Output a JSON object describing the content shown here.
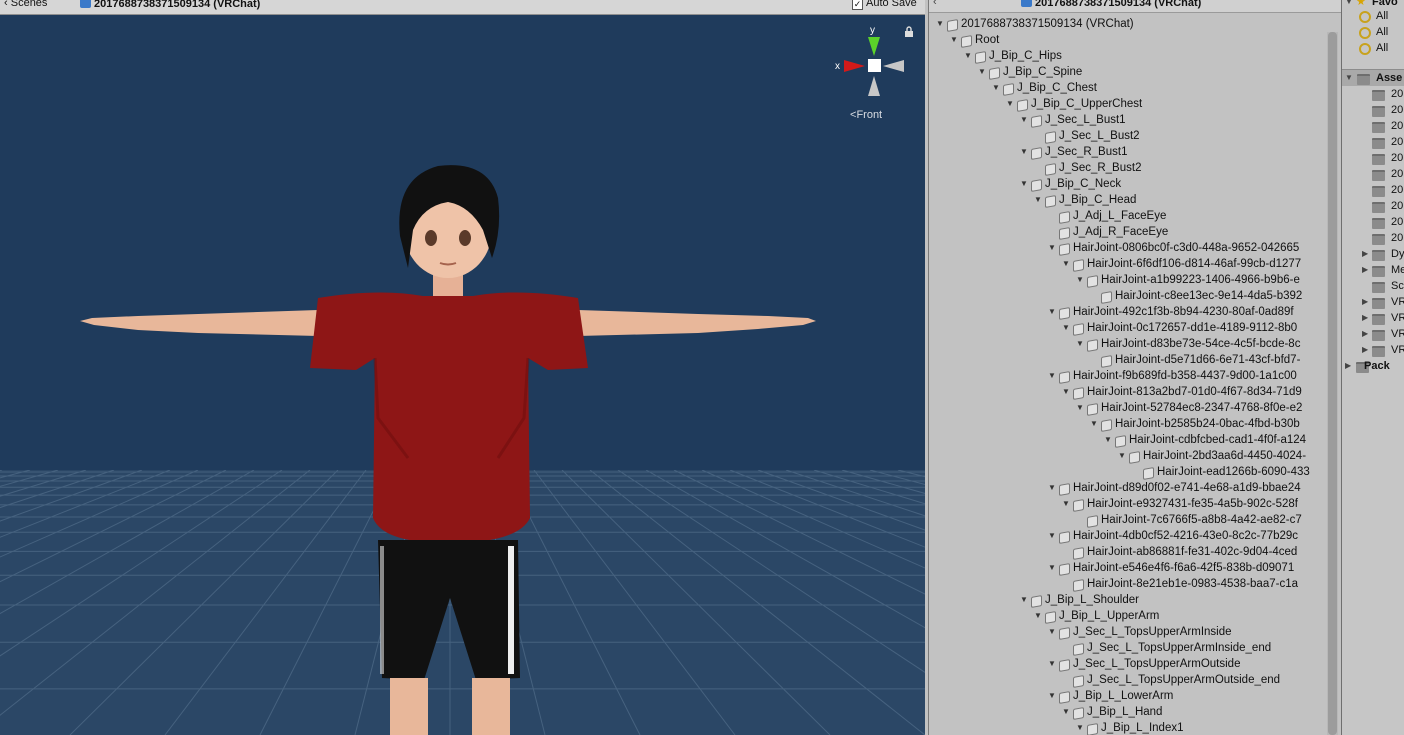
{
  "scene": {
    "tab_label": "Scenes",
    "prefab_title": "2017688738371509134 (VRChat)",
    "auto_save_label": "Auto Save",
    "auto_save_checked": true,
    "gizmo": {
      "axis_y": "y",
      "axis_x": "x",
      "view_label": "Front"
    },
    "background_color": "#1f3b5c"
  },
  "hierarchy": {
    "title": "2017688738371509134 (VRChat)",
    "rows": [
      {
        "label": "2017688738371509134 (VRChat)",
        "depth": 0,
        "expanded": true
      },
      {
        "label": "Root",
        "depth": 1,
        "expanded": true
      },
      {
        "label": "J_Bip_C_Hips",
        "depth": 2,
        "expanded": true
      },
      {
        "label": "J_Bip_C_Spine",
        "depth": 3,
        "expanded": true
      },
      {
        "label": "J_Bip_C_Chest",
        "depth": 4,
        "expanded": true
      },
      {
        "label": "J_Bip_C_UpperChest",
        "depth": 5,
        "expanded": true
      },
      {
        "label": "J_Sec_L_Bust1",
        "depth": 6,
        "expanded": true
      },
      {
        "label": "J_Sec_L_Bust2",
        "depth": 7,
        "expanded": false
      },
      {
        "label": "J_Sec_R_Bust1",
        "depth": 6,
        "expanded": true
      },
      {
        "label": "J_Sec_R_Bust2",
        "depth": 7,
        "expanded": false
      },
      {
        "label": "J_Bip_C_Neck",
        "depth": 6,
        "expanded": true
      },
      {
        "label": "J_Bip_C_Head",
        "depth": 7,
        "expanded": true
      },
      {
        "label": "J_Adj_L_FaceEye",
        "depth": 8,
        "expanded": false
      },
      {
        "label": "J_Adj_R_FaceEye",
        "depth": 8,
        "expanded": false
      },
      {
        "label": "HairJoint-0806bc0f-c3d0-448a-9652-042665",
        "depth": 8,
        "expanded": true
      },
      {
        "label": "HairJoint-6f6df106-d814-46af-99cb-d1277",
        "depth": 9,
        "expanded": true
      },
      {
        "label": "HairJoint-a1b99223-1406-4966-b9b6-e",
        "depth": 10,
        "expanded": true
      },
      {
        "label": "HairJoint-c8ee13ec-9e14-4da5-b392",
        "depth": 11,
        "expanded": false
      },
      {
        "label": "HairJoint-492c1f3b-8b94-4230-80af-0ad89f",
        "depth": 8,
        "expanded": true
      },
      {
        "label": "HairJoint-0c172657-dd1e-4189-9112-8b0",
        "depth": 9,
        "expanded": true
      },
      {
        "label": "HairJoint-d83be73e-54ce-4c5f-bcde-8c",
        "depth": 10,
        "expanded": true
      },
      {
        "label": "HairJoint-d5e71d66-6e71-43cf-bfd7-",
        "depth": 11,
        "expanded": false
      },
      {
        "label": "HairJoint-f9b689fd-b358-4437-9d00-1a1c00",
        "depth": 8,
        "expanded": true
      },
      {
        "label": "HairJoint-813a2bd7-01d0-4f67-8d34-71d9",
        "depth": 9,
        "expanded": true
      },
      {
        "label": "HairJoint-52784ec8-2347-4768-8f0e-e2",
        "depth": 10,
        "expanded": true
      },
      {
        "label": "HairJoint-b2585b24-0bac-4fbd-b30b",
        "depth": 11,
        "expanded": true
      },
      {
        "label": "HairJoint-cdbfcbed-cad1-4f0f-a124",
        "depth": 12,
        "expanded": true
      },
      {
        "label": "HairJoint-2bd3aa6d-4450-4024-",
        "depth": 13,
        "expanded": true
      },
      {
        "label": "HairJoint-ead1266b-6090-433",
        "depth": 14,
        "expanded": false
      },
      {
        "label": "HairJoint-d89d0f02-e741-4e68-a1d9-bbae24",
        "depth": 8,
        "expanded": true
      },
      {
        "label": "HairJoint-e9327431-fe35-4a5b-902c-528f",
        "depth": 9,
        "expanded": true
      },
      {
        "label": "HairJoint-7c6766f5-a8b8-4a42-ae82-c7",
        "depth": 10,
        "expanded": false
      },
      {
        "label": "HairJoint-4db0cf52-4216-43e0-8c2c-77b29c",
        "depth": 8,
        "expanded": true
      },
      {
        "label": "HairJoint-ab86881f-fe31-402c-9d04-4ced",
        "depth": 9,
        "expanded": false
      },
      {
        "label": "HairJoint-e546e4f6-f6a6-42f5-838b-d09071",
        "depth": 8,
        "expanded": true
      },
      {
        "label": "HairJoint-8e21eb1e-0983-4538-baa7-c1a",
        "depth": 9,
        "expanded": false
      },
      {
        "label": "J_Bip_L_Shoulder",
        "depth": 6,
        "expanded": true
      },
      {
        "label": "J_Bip_L_UpperArm",
        "depth": 7,
        "expanded": true
      },
      {
        "label": "J_Sec_L_TopsUpperArmInside",
        "depth": 8,
        "expanded": true
      },
      {
        "label": "J_Sec_L_TopsUpperArmInside_end",
        "depth": 9,
        "expanded": false
      },
      {
        "label": "J_Sec_L_TopsUpperArmOutside",
        "depth": 8,
        "expanded": true
      },
      {
        "label": "J_Sec_L_TopsUpperArmOutside_end",
        "depth": 9,
        "expanded": false
      },
      {
        "label": "J_Bip_L_LowerArm",
        "depth": 8,
        "expanded": true
      },
      {
        "label": "J_Bip_L_Hand",
        "depth": 9,
        "expanded": true
      },
      {
        "label": "J_Bip_L_Index1",
        "depth": 10,
        "expanded": true
      }
    ]
  },
  "project": {
    "favorites_label": "Favo",
    "favorites": [
      "All",
      "All",
      "All"
    ],
    "assets_label": "Asse",
    "asset_folders": [
      "20",
      "20",
      "20",
      "20",
      "20",
      "20",
      "20",
      "20",
      "20",
      "20"
    ],
    "collapsed_folders": [
      "Dy",
      "Me",
      "Sc",
      "VR",
      "VR",
      "VR",
      "VR"
    ],
    "packages_label": "Pack"
  }
}
